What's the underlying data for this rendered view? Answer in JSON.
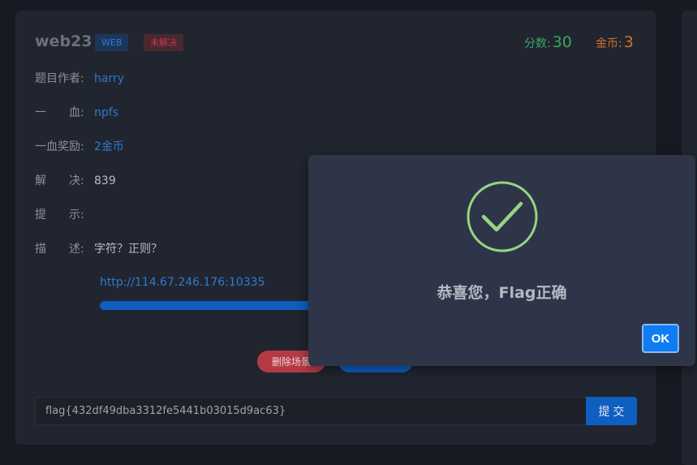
{
  "challenge": {
    "title": "web23",
    "category_badge": "WEB",
    "status_badge": "未解决",
    "points_label": "分数:",
    "points_value": "30",
    "coins_label": "金币:",
    "coins_value": "3"
  },
  "info": [
    {
      "label": "题目作者:",
      "value": "harry"
    },
    {
      "label": "一　　血:",
      "value": "npfs"
    },
    {
      "label": "一血奖励:",
      "value": "2金币"
    },
    {
      "label": "解　　决:",
      "value": "839"
    },
    {
      "label": "提　　示:",
      "value": ""
    },
    {
      "label": "描　　述:",
      "value": "字符？正则？"
    }
  ],
  "instance": {
    "url": "http://114.67.246.176:10335",
    "progress": 1.0,
    "delete_label": "删除场景"
  },
  "flag": {
    "value": "flag{432df49dba3312fe5441b03015d9ac63}",
    "submit_label": "提 交"
  },
  "modal": {
    "message": "恭喜您，Flag正确",
    "ok_label": "OK",
    "icon": "check-circle-icon",
    "icon_color": "#9ad381"
  },
  "colors": {
    "background": "#171a23",
    "card": "#21252f",
    "accent_blue": "#0f5fc0",
    "points_green": "#35a863",
    "coins_orange": "#d3712e",
    "danger_red": "#b53a46"
  }
}
